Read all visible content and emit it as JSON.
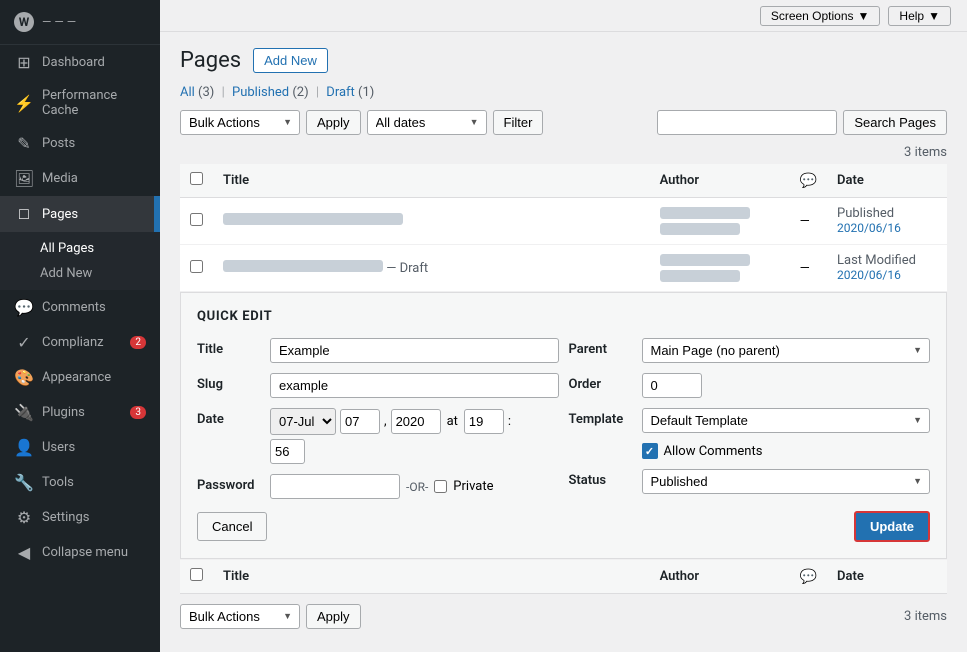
{
  "topbar": {
    "screen_options_label": "Screen Options",
    "help_label": "Help"
  },
  "sidebar": {
    "logo_text": "— — —",
    "items": [
      {
        "id": "dashboard",
        "icon": "⊞",
        "label": "Dashboard"
      },
      {
        "id": "performance-cache",
        "icon": "⚡",
        "label": "Performance Cache"
      },
      {
        "id": "posts",
        "icon": "✎",
        "label": "Posts"
      },
      {
        "id": "media",
        "icon": "🖼",
        "label": "Media"
      },
      {
        "id": "pages",
        "icon": "□",
        "label": "Pages",
        "active": true
      },
      {
        "id": "comments",
        "icon": "💬",
        "label": "Comments"
      },
      {
        "id": "complianz",
        "icon": "✓",
        "label": "Complianz",
        "badge": "2"
      },
      {
        "id": "appearance",
        "icon": "🎨",
        "label": "Appearance"
      },
      {
        "id": "plugins",
        "icon": "🔌",
        "label": "Plugins",
        "badge": "3"
      },
      {
        "id": "users",
        "icon": "👤",
        "label": "Users"
      },
      {
        "id": "tools",
        "icon": "🔧",
        "label": "Tools"
      },
      {
        "id": "settings",
        "icon": "⚙",
        "label": "Settings"
      },
      {
        "id": "collapse",
        "icon": "◀",
        "label": "Collapse menu"
      }
    ],
    "pages_subitems": [
      {
        "id": "all-pages",
        "label": "All Pages",
        "active": true
      },
      {
        "id": "add-new",
        "label": "Add New"
      }
    ]
  },
  "header": {
    "title": "Pages",
    "add_new_label": "Add New"
  },
  "filter_links": {
    "all_label": "All",
    "all_count": "(3)",
    "published_label": "Published",
    "published_count": "(2)",
    "draft_label": "Draft",
    "draft_count": "(1)",
    "items_count": "3 items"
  },
  "toolbar": {
    "bulk_actions_label": "Bulk Actions",
    "apply_label": "Apply",
    "all_dates_label": "All dates",
    "filter_label": "Filter",
    "search_placeholder": "",
    "search_btn_label": "Search Pages"
  },
  "table": {
    "col_title": "Title",
    "col_author": "Author",
    "col_date": "Date",
    "rows": [
      {
        "id": "row1",
        "title_blurred": true,
        "title_width": 180,
        "author_blurred1": true,
        "author_w1": 90,
        "author_blurred2": true,
        "author_w2": 80,
        "comments": "—",
        "status": "Published",
        "date": "2020/06/16"
      },
      {
        "id": "row2",
        "title_blurred": true,
        "title_width": 180,
        "draft_label": "— Draft",
        "author_blurred1": true,
        "author_w1": 90,
        "author_blurred2": true,
        "author_w2": 80,
        "comments": "—",
        "status": "Last Modified",
        "date": "2020/06/16"
      }
    ]
  },
  "quick_edit": {
    "section_title": "QUICK EDIT",
    "title_label": "Title",
    "title_value": "Example",
    "slug_label": "Slug",
    "slug_value": "example",
    "date_label": "Date",
    "date_month": "07-Jul",
    "date_day": "07",
    "date_year": "2020",
    "date_at": "at",
    "date_hour": "19",
    "date_colon": ":",
    "date_min": "56",
    "password_label": "Password",
    "password_value": "",
    "or_text": "-OR-",
    "private_label": "Private",
    "parent_label": "Parent",
    "parent_value": "Main Page (no parent)",
    "order_label": "Order",
    "order_value": "0",
    "template_label": "Template",
    "template_value": "Default Template",
    "allow_comments_label": "Allow Comments",
    "status_label": "Status",
    "status_value": "Published",
    "cancel_label": "Cancel",
    "update_label": "Update"
  },
  "bottom_toolbar": {
    "bulk_actions_label": "Bulk Actions",
    "apply_label": "Apply",
    "items_count": "3 items"
  }
}
